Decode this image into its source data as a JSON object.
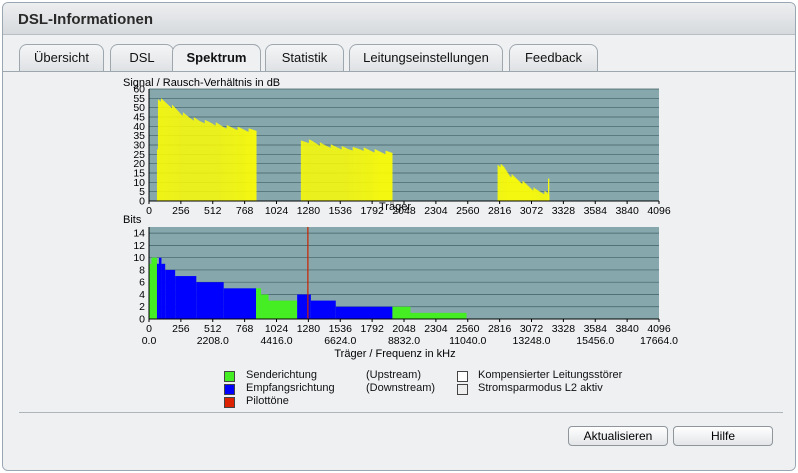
{
  "window": {
    "title": "DSL-Informationen"
  },
  "tabs": [
    {
      "label": "Übersicht",
      "active": false
    },
    {
      "label": "DSL",
      "active": false
    },
    {
      "label": "Spektrum",
      "active": true
    },
    {
      "label": "Statistik",
      "active": false
    },
    {
      "label": "Leitungseinstellungen",
      "active": false
    },
    {
      "label": "Feedback",
      "active": false
    }
  ],
  "chart_data": [
    {
      "type": "bar",
      "title": "Signal / Rausch-Verhältnis in dB",
      "xlabel": "Träger",
      "ylabel": "",
      "xlim": [
        0,
        4096
      ],
      "ylim": [
        0,
        60
      ],
      "xticks": [
        "0",
        "256",
        "512",
        "768",
        "1024",
        "1280",
        "1536",
        "1792",
        "2048",
        "2304",
        "2560",
        "2816",
        "3072",
        "3328",
        "3584",
        "3840",
        "4096"
      ],
      "yticks": [
        "0",
        "5",
        "10",
        "15",
        "20",
        "25",
        "30",
        "35",
        "40",
        "45",
        "50",
        "55",
        "60"
      ],
      "grid": true,
      "colors": {
        "plot_bg": "#86a8ad",
        "bars": "#ffff00"
      },
      "segments": [
        {
          "x": [
            64,
            860
          ],
          "y": [
            [
              64,
              0
            ],
            [
              70,
              42
            ],
            [
              72,
              55
            ],
            [
              100,
              54
            ],
            [
              150,
              52
            ],
            [
              200,
              50
            ],
            [
              260,
              47
            ],
            [
              320,
              45
            ],
            [
              400,
              43
            ],
            [
              500,
              42
            ],
            [
              600,
              40
            ],
            [
              700,
              39
            ],
            [
              800,
              38
            ],
            [
              860,
              38
            ]
          ]
        },
        {
          "x": [
            1220,
            1955
          ],
          "y": [
            [
              1220,
              32
            ],
            [
              1300,
              32
            ],
            [
              1400,
              30
            ],
            [
              1500,
              29
            ],
            [
              1600,
              28
            ],
            [
              1700,
              28
            ],
            [
              1800,
              27
            ],
            [
              1900,
              26
            ],
            [
              1955,
              26
            ]
          ]
        },
        {
          "x": [
            2800,
            3210
          ],
          "y": [
            [
              2800,
              20
            ],
            [
              2850,
              18
            ],
            [
              2900,
              14
            ],
            [
              2950,
              12
            ],
            [
              3000,
              10
            ],
            [
              3050,
              8
            ],
            [
              3100,
              6
            ],
            [
              3150,
              5
            ],
            [
              3200,
              4
            ],
            [
              3210,
              3
            ]
          ]
        }
      ],
      "notes_spikes": [
        [
          3205,
          12
        ]
      ]
    },
    {
      "type": "bar",
      "title": "Bits",
      "xlabel": "Träger / Frequenz in kHz",
      "ylabel": "",
      "xlim": [
        0,
        4096
      ],
      "ylim": [
        0,
        15
      ],
      "xticks": [
        "0",
        "256",
        "512",
        "768",
        "1024",
        "1280",
        "1536",
        "1792",
        "2048",
        "2304",
        "2560",
        "2816",
        "3072",
        "3328",
        "3584",
        "3840",
        "4096"
      ],
      "xticks_freq": [
        "0.0",
        "2208.0",
        "4416.0",
        "6624.0",
        "8832.0",
        "11040.0",
        "13248.0",
        "15456.0",
        "17664.0"
      ],
      "yticks": [
        "0",
        "2",
        "4",
        "6",
        "8",
        "10",
        "12",
        "14"
      ],
      "grid": true,
      "colors": {
        "plot_bg": "#86a8ad",
        "upstream": "#44ee22",
        "downstream": "#0000ff",
        "pilot": "#cc2200"
      },
      "series": [
        {
          "name": "Senderichtung",
          "kind": "upstream",
          "steps": [
            [
              0,
              9
            ],
            [
              20,
              10
            ],
            [
              40,
              10
            ],
            [
              64,
              0
            ]
          ]
        },
        {
          "name": "Empfangsrichtung",
          "kind": "downstream",
          "steps": [
            [
              64,
              9
            ],
            [
              80,
              10
            ],
            [
              100,
              9
            ],
            [
              130,
              8
            ],
            [
              210,
              7
            ],
            [
              380,
              6
            ],
            [
              600,
              5
            ],
            [
              860,
              5
            ]
          ]
        },
        {
          "name": "Senderichtung",
          "kind": "upstream",
          "steps": [
            [
              860,
              5
            ],
            [
              900,
              4
            ],
            [
              960,
              3
            ],
            [
              1190,
              3
            ]
          ]
        },
        {
          "name": "Empfangsrichtung",
          "kind": "downstream",
          "steps": [
            [
              1190,
              4
            ],
            [
              1300,
              3
            ],
            [
              1500,
              2
            ],
            [
              1955,
              2
            ]
          ]
        },
        {
          "name": "Senderichtung",
          "kind": "upstream",
          "steps": [
            [
              1955,
              2
            ],
            [
              2100,
              1
            ],
            [
              2550,
              1
            ]
          ]
        }
      ],
      "pilot_carrier": 1276
    }
  ],
  "legend": [
    {
      "label": "Senderichtung",
      "color": "#44ee22"
    },
    {
      "label": "Empfangsrichtung",
      "color": "#0000ff"
    },
    {
      "label": "Pilottöne",
      "color": "#dd2200"
    }
  ],
  "legend_direction": [
    "(Upstream)",
    "(Downstream)"
  ],
  "legend_right": [
    {
      "label": "Kompensierter Leitungsstörer",
      "color": "#ffffff"
    },
    {
      "label": "Stromsparmodus L2 aktiv",
      "color": "#eeeeee"
    }
  ],
  "buttons": {
    "refresh": "Aktualisieren",
    "help": "Hilfe"
  }
}
